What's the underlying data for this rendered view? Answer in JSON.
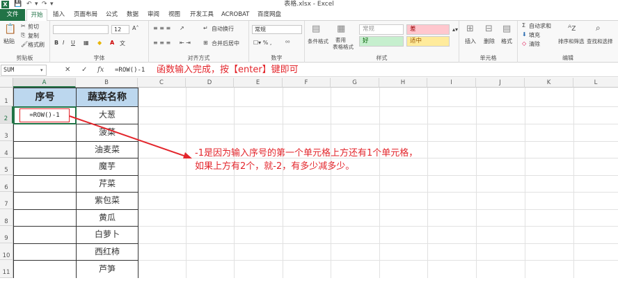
{
  "app": {
    "window_title": "表格.xlsx - Excel",
    "quick_access": [
      "保存",
      "撤销",
      "恢复"
    ]
  },
  "menu": {
    "tabs": [
      "文件",
      "开始",
      "插入",
      "页面布局",
      "公式",
      "数据",
      "审阅",
      "视图",
      "开发工具",
      "ACROBAT",
      "百度网盘"
    ],
    "active": "开始"
  },
  "ribbon": {
    "clipboard": {
      "paste": "粘贴",
      "cut": "剪切",
      "copy": "复制",
      "format_painter": "格式刷",
      "label": "剪贴板"
    },
    "font": {
      "size": "12",
      "bold": "B",
      "italic": "I",
      "underline": "U",
      "label": "字体"
    },
    "alignment": {
      "wrap": "自动换行",
      "merge": "合并后居中",
      "label": "对齐方式"
    },
    "number": {
      "format": "常规",
      "label": "数字"
    },
    "styles": {
      "cond_format": "条件格式",
      "table_format": "套用",
      "table_format2": "表格格式",
      "normal": "常规",
      "bad": "差",
      "good": "好",
      "neutral": "适中",
      "label": "样式"
    },
    "cells": {
      "insert": "插入",
      "delete": "删除",
      "format": "格式",
      "label": "单元格"
    },
    "editing": {
      "autosum": "自动求和",
      "fill": "填充",
      "clear": "清除",
      "sort": "排序和筛选",
      "find": "查找和选择",
      "label": "编辑"
    }
  },
  "formula_bar": {
    "name_box": "SUM",
    "cancel": "✕",
    "enter": "✓",
    "fx": "fx",
    "content": "=ROW()-1"
  },
  "annotation_top": "函数输入完成，按【enter】键即可",
  "annotation_note": [
    "-1是因为输入序号的第一个单元格上方还有1个单元格，",
    "如果上方有2个，就-2，有多少减多少。"
  ],
  "sheet": {
    "columns": [
      "A",
      "B",
      "C",
      "D",
      "E",
      "F",
      "G",
      "H",
      "I",
      "J",
      "K",
      "L"
    ],
    "rows": [
      "1",
      "2",
      "3",
      "4",
      "5",
      "6",
      "7",
      "8",
      "9",
      "10",
      "11"
    ],
    "header_a": "序号",
    "header_b": "蔬菜名称",
    "editing_cell": "=ROW()-1",
    "vegetables": [
      "大葱",
      "菠菜",
      "油麦菜",
      "魔芋",
      "芹菜",
      "紫包菜",
      "黄瓜",
      "白萝卜",
      "西红柿",
      "芦笋"
    ]
  },
  "colors": {
    "excel_green": "#217346",
    "header_fill": "#bcd7ee",
    "annotation_red": "#e3262c"
  }
}
